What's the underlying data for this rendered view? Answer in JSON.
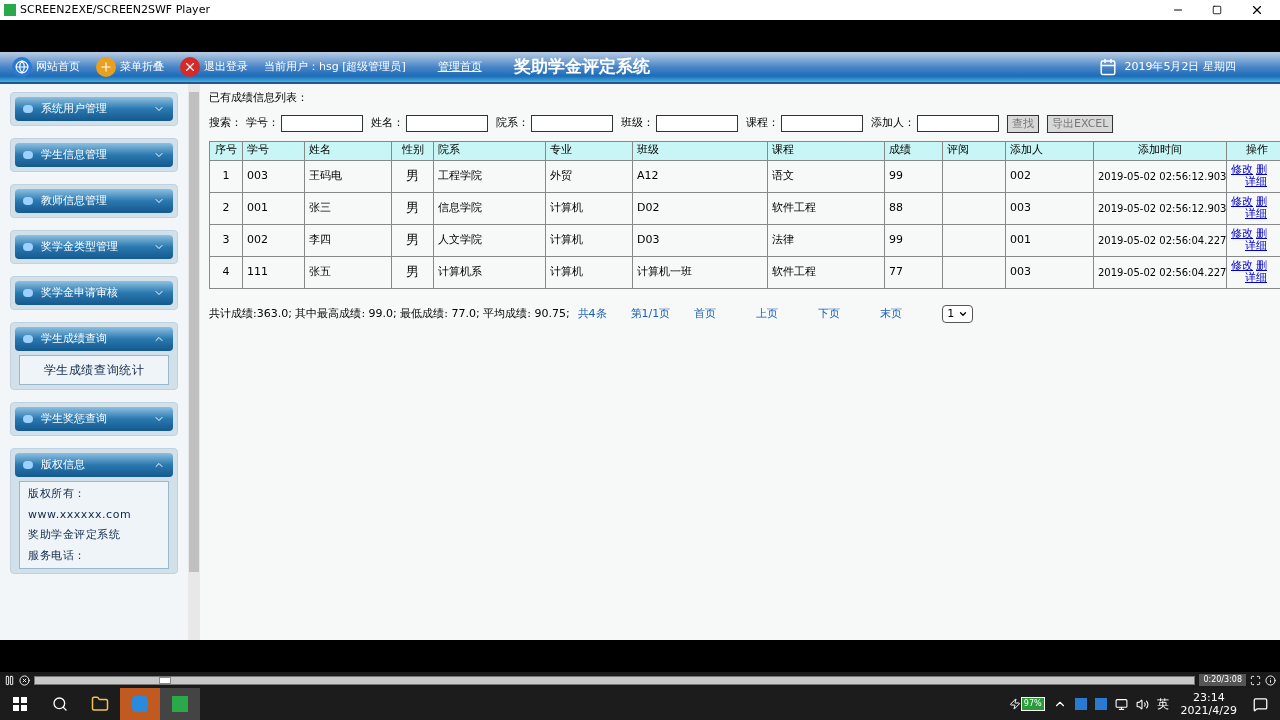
{
  "window": {
    "title": "SCREEN2EXE/SCREEN2SWF Player"
  },
  "header": {
    "links": [
      {
        "kind": "globe",
        "label": "网站首页"
      },
      {
        "kind": "plus",
        "label": "菜单折叠"
      },
      {
        "kind": "close",
        "label": "退出登录"
      }
    ],
    "user": "当前用户：hsg [超级管理员]",
    "home": "管理首页",
    "title": "奖助学金评定系统",
    "date": "2019年5月2日 星期四"
  },
  "sidebar": {
    "groups": [
      {
        "label": "系统用户管理",
        "expanded": false
      },
      {
        "label": "学生信息管理",
        "expanded": false
      },
      {
        "label": "教师信息管理",
        "expanded": false
      },
      {
        "label": "奖学金类型管理",
        "expanded": false
      },
      {
        "label": "奖学金申请审核",
        "expanded": false
      },
      {
        "label": "学生成绩查询",
        "expanded": true,
        "children": [
          "学生成绩查询统计"
        ]
      },
      {
        "label": "学生奖惩查询",
        "expanded": false
      },
      {
        "label": "版权信息",
        "expanded": true,
        "info": [
          "版权所有：",
          "www.xxxxxx.com",
          "奖助学金评定系统",
          "服务电话："
        ]
      }
    ]
  },
  "main": {
    "heading": "已有成绩信息列表：",
    "search_label": "搜索：",
    "filters": [
      "学号：",
      "姓名：",
      "院系：",
      "班级：",
      "课程：",
      "添加人："
    ],
    "buttons": [
      "查找",
      "导出EXCEL"
    ],
    "table": {
      "columns": [
        "序号",
        "学号",
        "姓名",
        "性别",
        "院系",
        "专业",
        "班级",
        "课程",
        "成绩",
        "评阅",
        "添加人",
        "添加时间",
        "操作"
      ],
      "rows": [
        {
          "cells": [
            "1",
            "003",
            "王码电",
            "男",
            "工程学院",
            "外贸",
            "A12",
            "语文",
            "99",
            "",
            "002",
            "2019-05-02 02:56:12.903"
          ],
          "actions": [
            "修改",
            "删",
            "详细"
          ]
        },
        {
          "cells": [
            "2",
            "001",
            "张三",
            "男",
            "信息学院",
            "计算机",
            "D02",
            "软件工程",
            "88",
            "",
            "003",
            "2019-05-02 02:56:12.903"
          ],
          "actions": [
            "修改",
            "删",
            "详细"
          ]
        },
        {
          "cells": [
            "3",
            "002",
            "李四",
            "男",
            "人文学院",
            "计算机",
            "D03",
            "法律",
            "99",
            "",
            "001",
            "2019-05-02 02:56:04.227"
          ],
          "actions": [
            "修改",
            "删",
            "详细"
          ]
        },
        {
          "cells": [
            "4",
            "111",
            "张五",
            "男",
            "计算机系",
            "计算机",
            "计算机一班",
            "软件工程",
            "77",
            "",
            "003",
            "2019-05-02 02:56:04.227"
          ],
          "actions": [
            "修改",
            "删",
            "详细"
          ]
        }
      ]
    },
    "summary": "共计成绩:363.0; 其中最高成绩: 99.0; 最低成绩: 77.0; 平均成绩: 90.75;",
    "pager": [
      "共4条",
      "第1/1页",
      "首页",
      "上页",
      "下页",
      "末页"
    ],
    "page_select": "1"
  },
  "player": {
    "level": 0.107,
    "time": "0:20/3:08"
  },
  "taskbar": {
    "battery": "97%",
    "ime": "英",
    "time": "23:14",
    "date": "2021/4/29"
  }
}
